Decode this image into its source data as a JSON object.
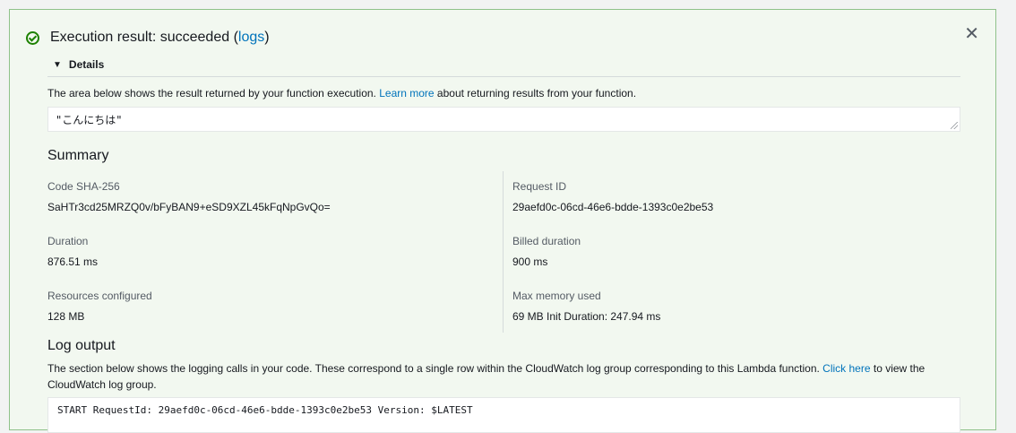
{
  "header": {
    "title_prefix": "Execution result: succeeded (",
    "logs_link": "logs",
    "title_suffix": ")",
    "close": "✕"
  },
  "details": {
    "label": "Details",
    "toggle_icon": "▼"
  },
  "result": {
    "desc_prefix": "The area below shows the result returned by your function execution. ",
    "learn_more": "Learn more",
    "desc_suffix": " about returning results from your function.",
    "value": "\"こんにちは\""
  },
  "summary": {
    "heading": "Summary",
    "code_sha_label": "Code SHA-256",
    "code_sha_value": "SaHTr3cd25MRZQ0v/bFyBAN9+eSD9XZL45kFqNpGvQo=",
    "request_id_label": "Request ID",
    "request_id_value": "29aefd0c-06cd-46e6-bdde-1393c0e2be53",
    "duration_label": "Duration",
    "duration_value": "876.51 ms",
    "billed_label": "Billed duration",
    "billed_value": "900 ms",
    "resources_label": "Resources configured",
    "resources_value": "128 MB",
    "maxmem_label": "Max memory used",
    "maxmem_value": "69 MB Init Duration: 247.94 ms"
  },
  "log": {
    "heading": "Log output",
    "desc_prefix": "The section below shows the logging calls in your code. These correspond to a single row within the CloudWatch log group corresponding to this Lambda function. ",
    "click_here": "Click here",
    "desc_suffix": " to view the CloudWatch log group.",
    "line1": "START RequestId: 29aefd0c-06cd-46e6-bdde-1393c0e2be53 Version: $LATEST"
  },
  "colors": {
    "success": "#1d8102",
    "link": "#0073bb",
    "border": "#8fc28a"
  }
}
